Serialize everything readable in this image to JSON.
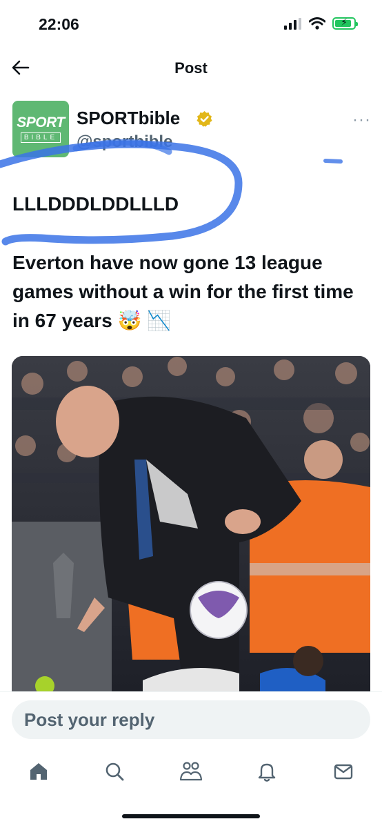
{
  "status_bar": {
    "time": "22:06",
    "battery_color": "#22c55e",
    "battery_level_percent": 90
  },
  "nav": {
    "title": "Post",
    "back_icon": "arrow-left-icon"
  },
  "author": {
    "avatar_text_top": "SPORT",
    "avatar_text_bottom": "BIBLE",
    "avatar_color": "#5fb873",
    "display_name": "SPORTbible",
    "verified_color": "#e2b719",
    "handle": "@sportbible",
    "more_label": "···"
  },
  "post": {
    "line1": "LLLDDDLDDLLLD",
    "line2": "Everton have now gone 13 league games without a win for the first time in 67 years 🤯 📉",
    "annotation_color": "#3b73e6"
  },
  "reply": {
    "placeholder": "Post your reply"
  },
  "tab_bar": {
    "tabs": [
      {
        "name": "home",
        "icon": "home-icon"
      },
      {
        "name": "search",
        "icon": "search-icon"
      },
      {
        "name": "communities",
        "icon": "communities-icon"
      },
      {
        "name": "notifications",
        "icon": "bell-icon"
      },
      {
        "name": "messages",
        "icon": "mail-icon"
      }
    ]
  }
}
